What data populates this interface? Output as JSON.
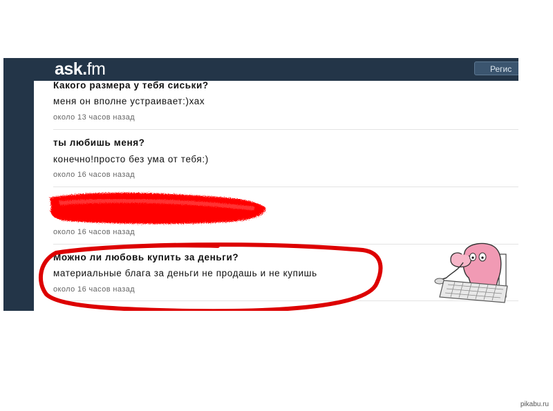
{
  "header": {
    "logo_main": "ask",
    "logo_dot": ".",
    "logo_tld": "fm",
    "register_label": "Регис"
  },
  "feed": [
    {
      "question": "Какого размера у тебя сиськи?",
      "answer": "меня он вполне устраивает:)хах",
      "time": "около 13 часов назад"
    },
    {
      "question": "ты любишь меня?",
      "answer": "конечно!просто без ума от тебя:)",
      "time": "около 16 часов назад"
    },
    {
      "question": "",
      "answer": "",
      "time": "около 16 часов назад"
    },
    {
      "question": "Можно ли любовь купить за деньги?",
      "answer": "материальные блага за деньги не продашь и не купишь",
      "time": "около 16 часов назад"
    }
  ],
  "watermark": "pikabu.ru",
  "colors": {
    "header_bg": "#233548",
    "redaction": "#ff0000",
    "highlight_circle": "#dd0000"
  },
  "icons": [
    "monkey-at-keyboard-illustration"
  ]
}
